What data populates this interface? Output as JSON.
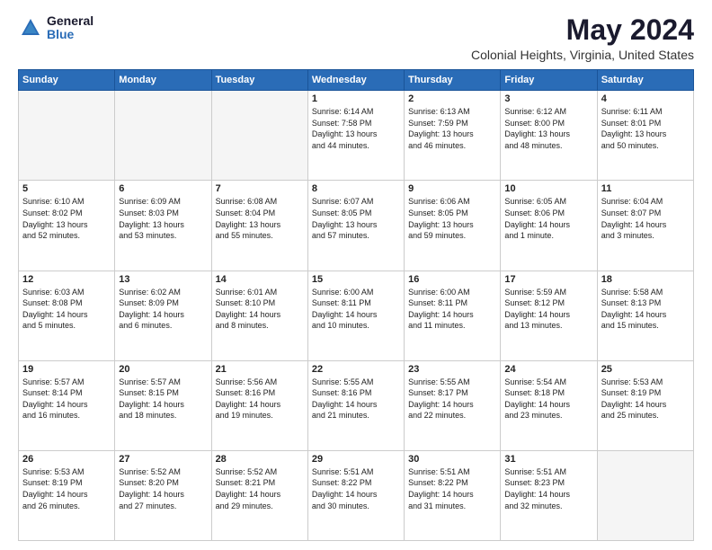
{
  "header": {
    "logo_general": "General",
    "logo_blue": "Blue",
    "month_title": "May 2024",
    "location": "Colonial Heights, Virginia, United States"
  },
  "days_of_week": [
    "Sunday",
    "Monday",
    "Tuesday",
    "Wednesday",
    "Thursday",
    "Friday",
    "Saturday"
  ],
  "weeks": [
    [
      {
        "day": "",
        "empty": true
      },
      {
        "day": "",
        "empty": true
      },
      {
        "day": "",
        "empty": true
      },
      {
        "day": "1",
        "lines": [
          "Sunrise: 6:14 AM",
          "Sunset: 7:58 PM",
          "Daylight: 13 hours",
          "and 44 minutes."
        ]
      },
      {
        "day": "2",
        "lines": [
          "Sunrise: 6:13 AM",
          "Sunset: 7:59 PM",
          "Daylight: 13 hours",
          "and 46 minutes."
        ]
      },
      {
        "day": "3",
        "lines": [
          "Sunrise: 6:12 AM",
          "Sunset: 8:00 PM",
          "Daylight: 13 hours",
          "and 48 minutes."
        ]
      },
      {
        "day": "4",
        "lines": [
          "Sunrise: 6:11 AM",
          "Sunset: 8:01 PM",
          "Daylight: 13 hours",
          "and 50 minutes."
        ]
      }
    ],
    [
      {
        "day": "5",
        "lines": [
          "Sunrise: 6:10 AM",
          "Sunset: 8:02 PM",
          "Daylight: 13 hours",
          "and 52 minutes."
        ]
      },
      {
        "day": "6",
        "lines": [
          "Sunrise: 6:09 AM",
          "Sunset: 8:03 PM",
          "Daylight: 13 hours",
          "and 53 minutes."
        ]
      },
      {
        "day": "7",
        "lines": [
          "Sunrise: 6:08 AM",
          "Sunset: 8:04 PM",
          "Daylight: 13 hours",
          "and 55 minutes."
        ]
      },
      {
        "day": "8",
        "lines": [
          "Sunrise: 6:07 AM",
          "Sunset: 8:05 PM",
          "Daylight: 13 hours",
          "and 57 minutes."
        ]
      },
      {
        "day": "9",
        "lines": [
          "Sunrise: 6:06 AM",
          "Sunset: 8:05 PM",
          "Daylight: 13 hours",
          "and 59 minutes."
        ]
      },
      {
        "day": "10",
        "lines": [
          "Sunrise: 6:05 AM",
          "Sunset: 8:06 PM",
          "Daylight: 14 hours",
          "and 1 minute."
        ]
      },
      {
        "day": "11",
        "lines": [
          "Sunrise: 6:04 AM",
          "Sunset: 8:07 PM",
          "Daylight: 14 hours",
          "and 3 minutes."
        ]
      }
    ],
    [
      {
        "day": "12",
        "lines": [
          "Sunrise: 6:03 AM",
          "Sunset: 8:08 PM",
          "Daylight: 14 hours",
          "and 5 minutes."
        ]
      },
      {
        "day": "13",
        "lines": [
          "Sunrise: 6:02 AM",
          "Sunset: 8:09 PM",
          "Daylight: 14 hours",
          "and 6 minutes."
        ]
      },
      {
        "day": "14",
        "lines": [
          "Sunrise: 6:01 AM",
          "Sunset: 8:10 PM",
          "Daylight: 14 hours",
          "and 8 minutes."
        ]
      },
      {
        "day": "15",
        "lines": [
          "Sunrise: 6:00 AM",
          "Sunset: 8:11 PM",
          "Daylight: 14 hours",
          "and 10 minutes."
        ]
      },
      {
        "day": "16",
        "lines": [
          "Sunrise: 6:00 AM",
          "Sunset: 8:11 PM",
          "Daylight: 14 hours",
          "and 11 minutes."
        ]
      },
      {
        "day": "17",
        "lines": [
          "Sunrise: 5:59 AM",
          "Sunset: 8:12 PM",
          "Daylight: 14 hours",
          "and 13 minutes."
        ]
      },
      {
        "day": "18",
        "lines": [
          "Sunrise: 5:58 AM",
          "Sunset: 8:13 PM",
          "Daylight: 14 hours",
          "and 15 minutes."
        ]
      }
    ],
    [
      {
        "day": "19",
        "lines": [
          "Sunrise: 5:57 AM",
          "Sunset: 8:14 PM",
          "Daylight: 14 hours",
          "and 16 minutes."
        ]
      },
      {
        "day": "20",
        "lines": [
          "Sunrise: 5:57 AM",
          "Sunset: 8:15 PM",
          "Daylight: 14 hours",
          "and 18 minutes."
        ]
      },
      {
        "day": "21",
        "lines": [
          "Sunrise: 5:56 AM",
          "Sunset: 8:16 PM",
          "Daylight: 14 hours",
          "and 19 minutes."
        ]
      },
      {
        "day": "22",
        "lines": [
          "Sunrise: 5:55 AM",
          "Sunset: 8:16 PM",
          "Daylight: 14 hours",
          "and 21 minutes."
        ]
      },
      {
        "day": "23",
        "lines": [
          "Sunrise: 5:55 AM",
          "Sunset: 8:17 PM",
          "Daylight: 14 hours",
          "and 22 minutes."
        ]
      },
      {
        "day": "24",
        "lines": [
          "Sunrise: 5:54 AM",
          "Sunset: 8:18 PM",
          "Daylight: 14 hours",
          "and 23 minutes."
        ]
      },
      {
        "day": "25",
        "lines": [
          "Sunrise: 5:53 AM",
          "Sunset: 8:19 PM",
          "Daylight: 14 hours",
          "and 25 minutes."
        ]
      }
    ],
    [
      {
        "day": "26",
        "lines": [
          "Sunrise: 5:53 AM",
          "Sunset: 8:19 PM",
          "Daylight: 14 hours",
          "and 26 minutes."
        ]
      },
      {
        "day": "27",
        "lines": [
          "Sunrise: 5:52 AM",
          "Sunset: 8:20 PM",
          "Daylight: 14 hours",
          "and 27 minutes."
        ]
      },
      {
        "day": "28",
        "lines": [
          "Sunrise: 5:52 AM",
          "Sunset: 8:21 PM",
          "Daylight: 14 hours",
          "and 29 minutes."
        ]
      },
      {
        "day": "29",
        "lines": [
          "Sunrise: 5:51 AM",
          "Sunset: 8:22 PM",
          "Daylight: 14 hours",
          "and 30 minutes."
        ]
      },
      {
        "day": "30",
        "lines": [
          "Sunrise: 5:51 AM",
          "Sunset: 8:22 PM",
          "Daylight: 14 hours",
          "and 31 minutes."
        ]
      },
      {
        "day": "31",
        "lines": [
          "Sunrise: 5:51 AM",
          "Sunset: 8:23 PM",
          "Daylight: 14 hours",
          "and 32 minutes."
        ]
      },
      {
        "day": "",
        "empty": true
      }
    ]
  ]
}
